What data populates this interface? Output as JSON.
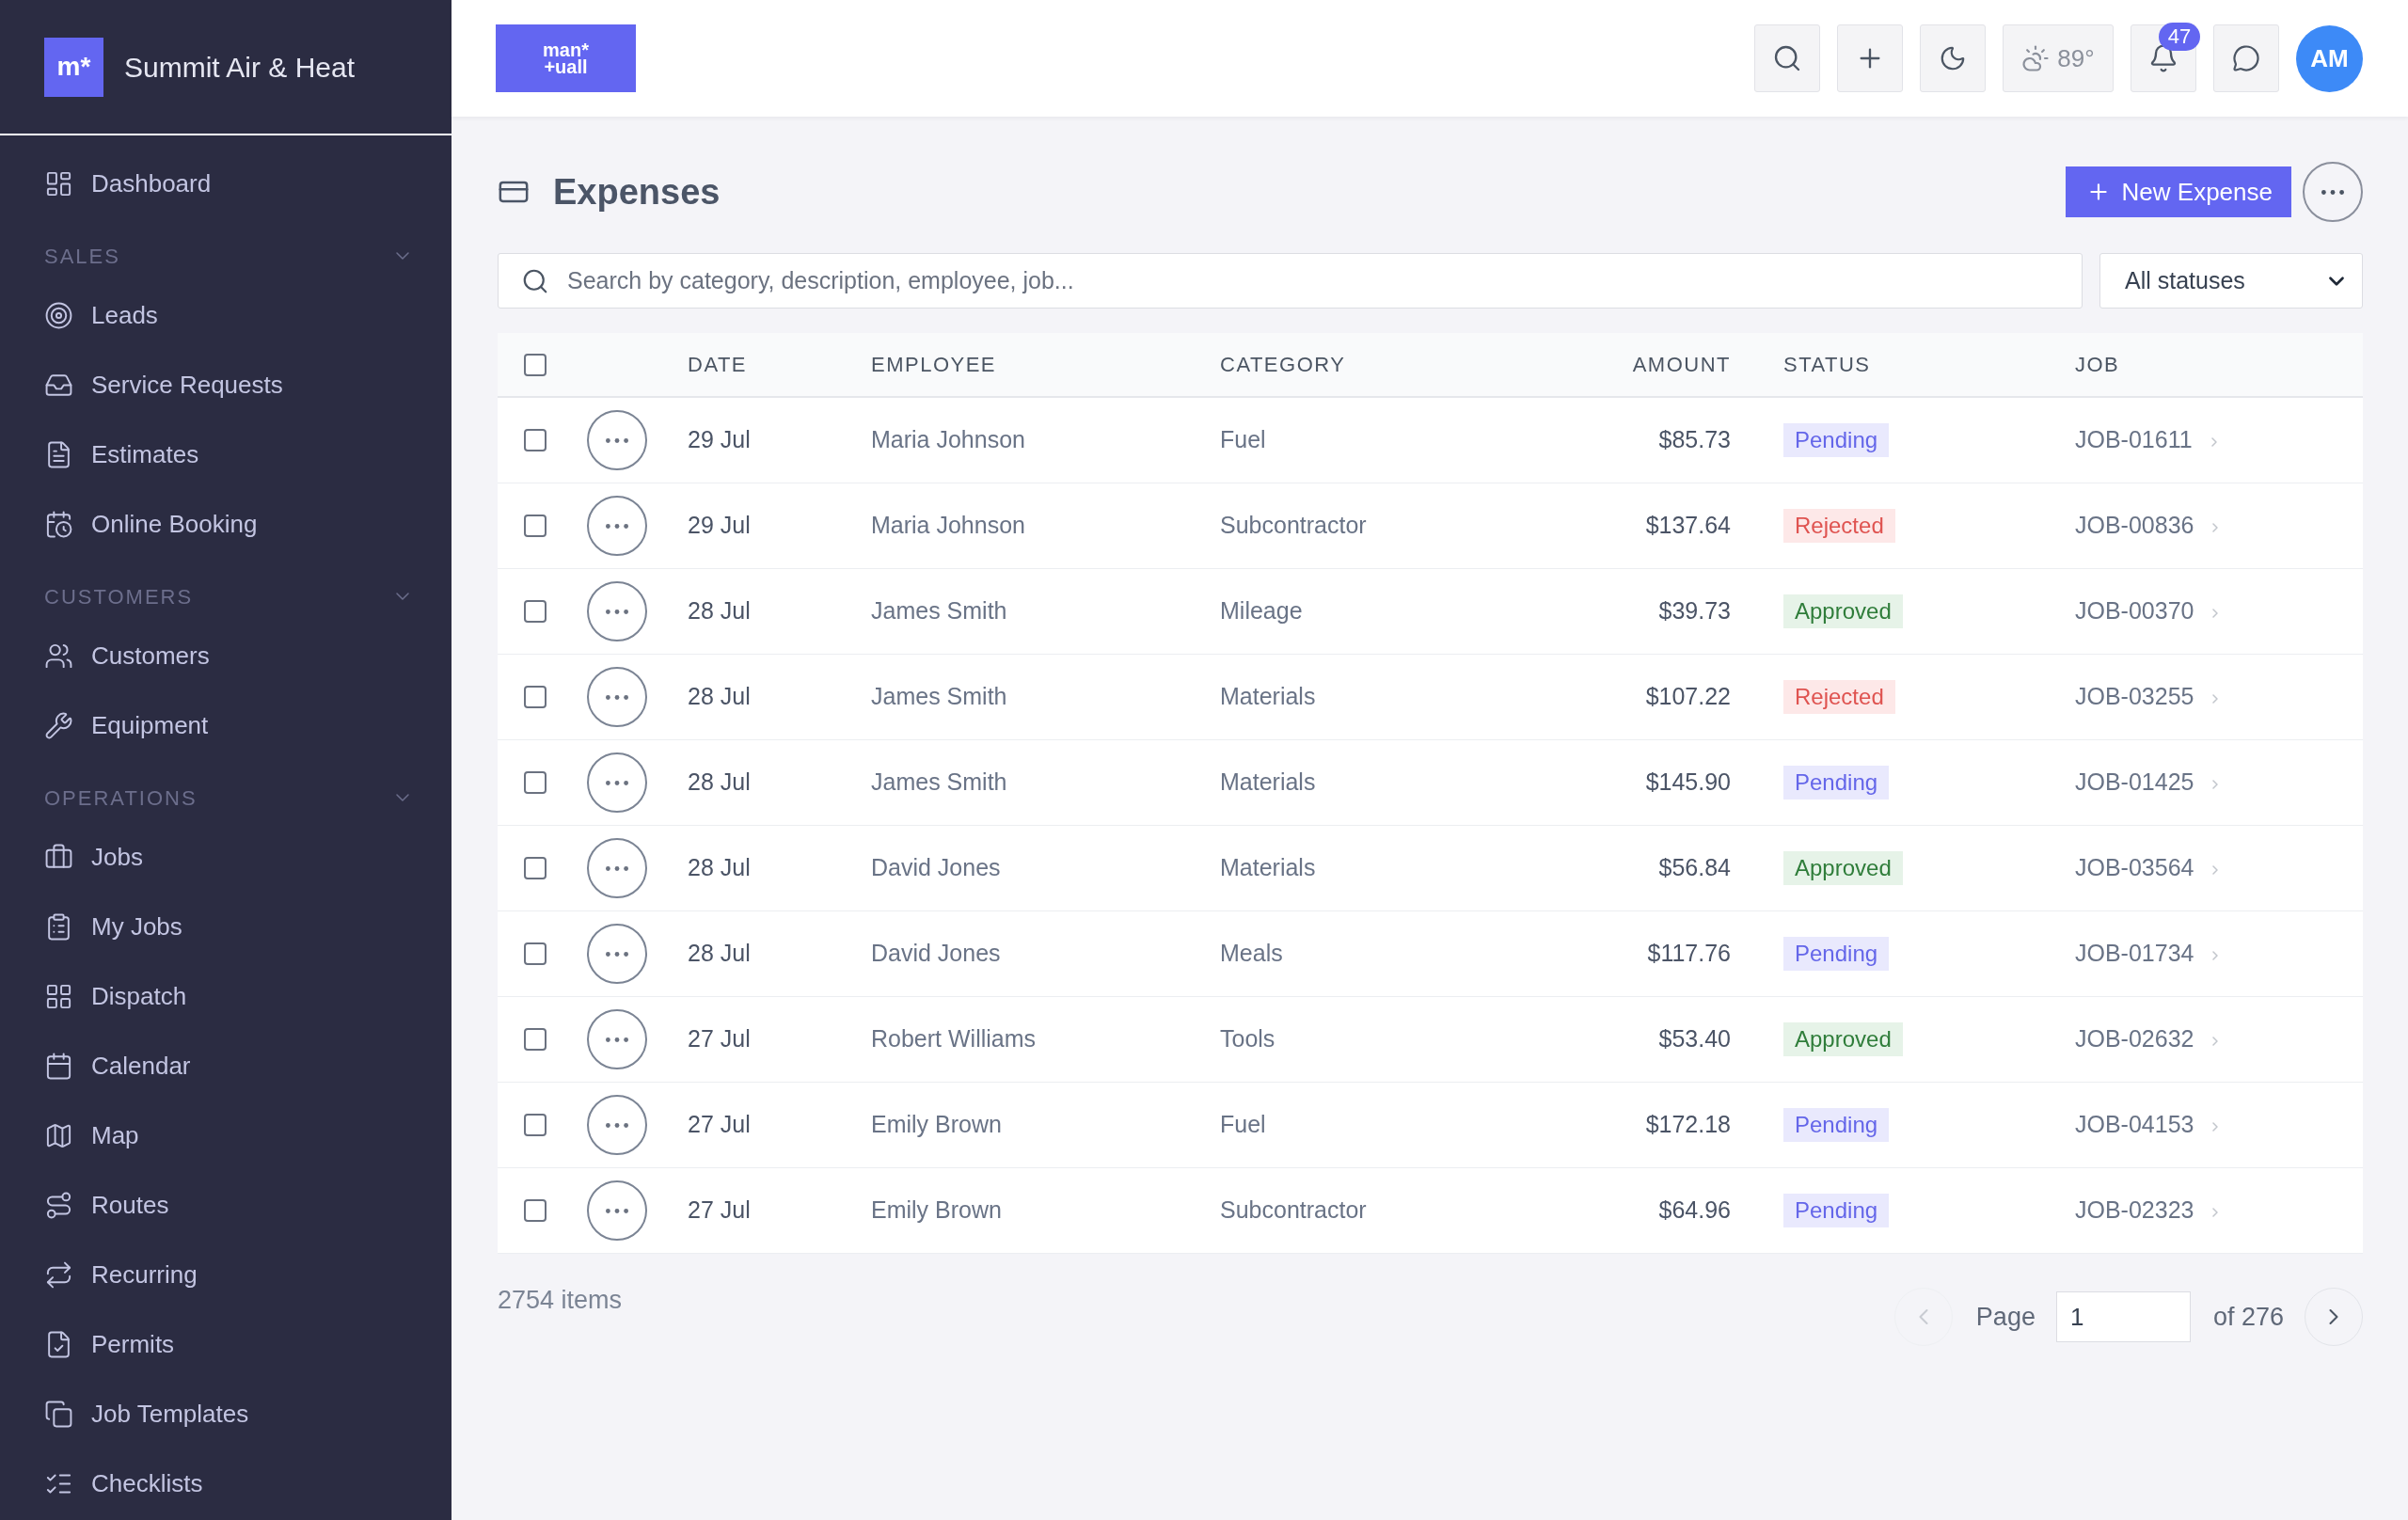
{
  "sidebar": {
    "brand": {
      "mark": "m*",
      "name": "Summit Air & Heat"
    },
    "items": [
      {
        "label": "Dashboard",
        "selected": false
      }
    ],
    "sections": [
      {
        "heading": "SALES",
        "expanded": true,
        "items": [
          {
            "label": "Leads",
            "selected": false
          },
          {
            "label": "Service Requests",
            "selected": false
          },
          {
            "label": "Estimates",
            "selected": false
          },
          {
            "label": "Online Booking",
            "selected": false
          }
        ]
      },
      {
        "heading": "CUSTOMERS",
        "expanded": true,
        "items": [
          {
            "label": "Customers",
            "selected": false
          },
          {
            "label": "Equipment",
            "selected": false
          }
        ]
      },
      {
        "heading": "OPERATIONS",
        "expanded": true,
        "items": [
          {
            "label": "Jobs",
            "selected": false
          },
          {
            "label": "My Jobs",
            "selected": false
          },
          {
            "label": "Dispatch",
            "selected": false
          },
          {
            "label": "Calendar",
            "selected": false
          },
          {
            "label": "Map",
            "selected": false
          },
          {
            "label": "Routes",
            "selected": false
          },
          {
            "label": "Recurring",
            "selected": false
          },
          {
            "label": "Permits",
            "selected": false
          },
          {
            "label": "Job Templates",
            "selected": false
          },
          {
            "label": "Checklists",
            "selected": false
          }
        ]
      }
    ]
  },
  "topbar": {
    "logo": [
      "man*",
      "+uall"
    ],
    "weather": "89°",
    "notifications": "47",
    "avatar": "AM"
  },
  "page": {
    "title": "Expenses",
    "new_button": "New Expense",
    "search": {
      "placeholder": "Search by category, description, employee, job..."
    },
    "status_filter": "All statuses"
  },
  "table": {
    "select_all": {
      "checked": false
    },
    "columns": [
      "DATE",
      "EMPLOYEE",
      "CATEGORY",
      "AMOUNT",
      "STATUS",
      "JOB"
    ],
    "rows": [
      {
        "checked": false,
        "date": "29 Jul",
        "employee": "Maria Johnson",
        "category": "Fuel",
        "amount": "$85.73",
        "status": {
          "label": "Pending",
          "kind": "pending"
        },
        "job": "JOB-01611"
      },
      {
        "checked": false,
        "date": "29 Jul",
        "employee": "Maria Johnson",
        "category": "Subcontractor",
        "amount": "$137.64",
        "status": {
          "label": "Rejected",
          "kind": "rejected"
        },
        "job": "JOB-00836"
      },
      {
        "checked": false,
        "date": "28 Jul",
        "employee": "James Smith",
        "category": "Mileage",
        "amount": "$39.73",
        "status": {
          "label": "Approved",
          "kind": "approved"
        },
        "job": "JOB-00370"
      },
      {
        "checked": false,
        "date": "28 Jul",
        "employee": "James Smith",
        "category": "Materials",
        "amount": "$107.22",
        "status": {
          "label": "Rejected",
          "kind": "rejected"
        },
        "job": "JOB-03255"
      },
      {
        "checked": false,
        "date": "28 Jul",
        "employee": "James Smith",
        "category": "Materials",
        "amount": "$145.90",
        "status": {
          "label": "Pending",
          "kind": "pending"
        },
        "job": "JOB-01425"
      },
      {
        "checked": false,
        "date": "28 Jul",
        "employee": "David Jones",
        "category": "Materials",
        "amount": "$56.84",
        "status": {
          "label": "Approved",
          "kind": "approved"
        },
        "job": "JOB-03564"
      },
      {
        "checked": false,
        "date": "28 Jul",
        "employee": "David Jones",
        "category": "Meals",
        "amount": "$117.76",
        "status": {
          "label": "Pending",
          "kind": "pending"
        },
        "job": "JOB-01734"
      },
      {
        "checked": false,
        "date": "27 Jul",
        "employee": "Robert Williams",
        "category": "Tools",
        "amount": "$53.40",
        "status": {
          "label": "Approved",
          "kind": "approved"
        },
        "job": "JOB-02632"
      },
      {
        "checked": false,
        "date": "27 Jul",
        "employee": "Emily Brown",
        "category": "Fuel",
        "amount": "$172.18",
        "status": {
          "label": "Pending",
          "kind": "pending"
        },
        "job": "JOB-04153"
      },
      {
        "checked": false,
        "date": "27 Jul",
        "employee": "Emily Brown",
        "category": "Subcontractor",
        "amount": "$64.96",
        "status": {
          "label": "Pending",
          "kind": "pending"
        },
        "job": "JOB-02323"
      }
    ]
  },
  "footer": {
    "count": "2754 items",
    "previous": {
      "disabled": true
    },
    "page_label": "Page",
    "page_value": "1",
    "page_total": "of 276",
    "next": {
      "disabled": false
    }
  }
}
